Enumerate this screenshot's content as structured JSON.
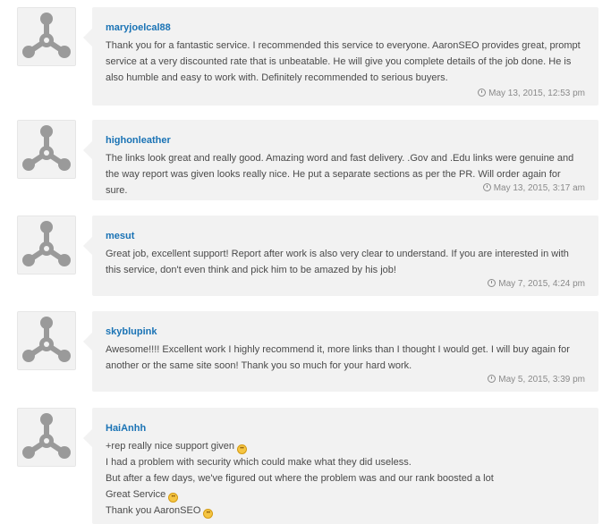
{
  "reviews": [
    {
      "user": "maryjoelcal88",
      "lines": [
        "Thank you for a fantastic service. I recommended this service to everyone. AaronSEO provides great, prompt",
        "service at a very discounted rate that is unbeatable. He will give you complete details of the job done. He is",
        "also humble and easy to work with. Definitely recommended to serious buyers."
      ],
      "date": "May 13, 2015, 12:53 pm"
    },
    {
      "user": "highonleather",
      "lines": [
        "The links look great and really good. Amazing word and fast delivery. .Gov and .Edu links were genuine and",
        "the way report was given looks really nice. He put a separate sections as per the PR. Will order again for sure."
      ],
      "date": "May 13, 2015, 3:17 am"
    },
    {
      "user": "mesut",
      "lines": [
        "Great job, excellent support! Report after work is also very clear to understand. If you are interested in with",
        "this service, don't even think and pick him to be amazed by his job!"
      ],
      "date": "May 7, 2015, 4:24 pm"
    },
    {
      "user": "skyblupink",
      "lines": [
        "Awesome!!!! Excellent work I highly recommend it, more links than I thought I would get. I will buy again for",
        "another or the same site soon! Thank you so much for your hard work."
      ],
      "date": "May 5, 2015, 3:39 pm"
    },
    {
      "user": "HaiAnhh",
      "lines": [
        "+rep really nice support given",
        "I had a problem with security which could make what they did useless.",
        "But after a few days, we've figured out where the problem was and our rank boosted a lot",
        "Great Service",
        "Thank you AaronSEO"
      ]
    }
  ],
  "icons": {
    "avatar": "default-avatar-icon",
    "clock": "clock-icon",
    "smiley": "smiley-emoji-icon"
  },
  "colors": {
    "username": "#1a73b5",
    "bubble_bg": "#f2f2f2",
    "text": "#4a4a4a",
    "date": "#8a8a8a",
    "avatar_glyph": "#9a9a9a"
  }
}
